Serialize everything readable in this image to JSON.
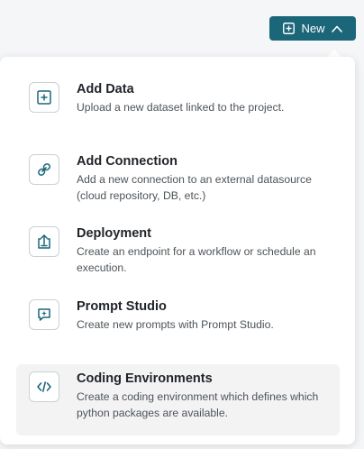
{
  "header": {
    "new_button_label": "New",
    "new_button_icon": "plus-square-icon",
    "toggle_icon": "chevron-up-icon",
    "accent_color": "#1b6679"
  },
  "menu": {
    "items": [
      {
        "title": "Add Data",
        "description": "Upload a new dataset linked to the project.",
        "icon": "plus-square-icon"
      },
      {
        "title": "Add Connection",
        "description": "Add a new connection to an external datasource (cloud repository, DB, etc.)",
        "icon": "link-icon"
      },
      {
        "title": "Deployment",
        "description": "Create an endpoint for a workflow or schedule an execution.",
        "icon": "deploy-icon"
      },
      {
        "title": "Prompt Studio",
        "description": "Create new prompts with Prompt Studio.",
        "icon": "chat-sparkle-icon"
      },
      {
        "title": "Coding Environments",
        "description": "Create a coding environment which defines which python packages are available.",
        "icon": "code-icon",
        "highlighted": true
      }
    ]
  }
}
